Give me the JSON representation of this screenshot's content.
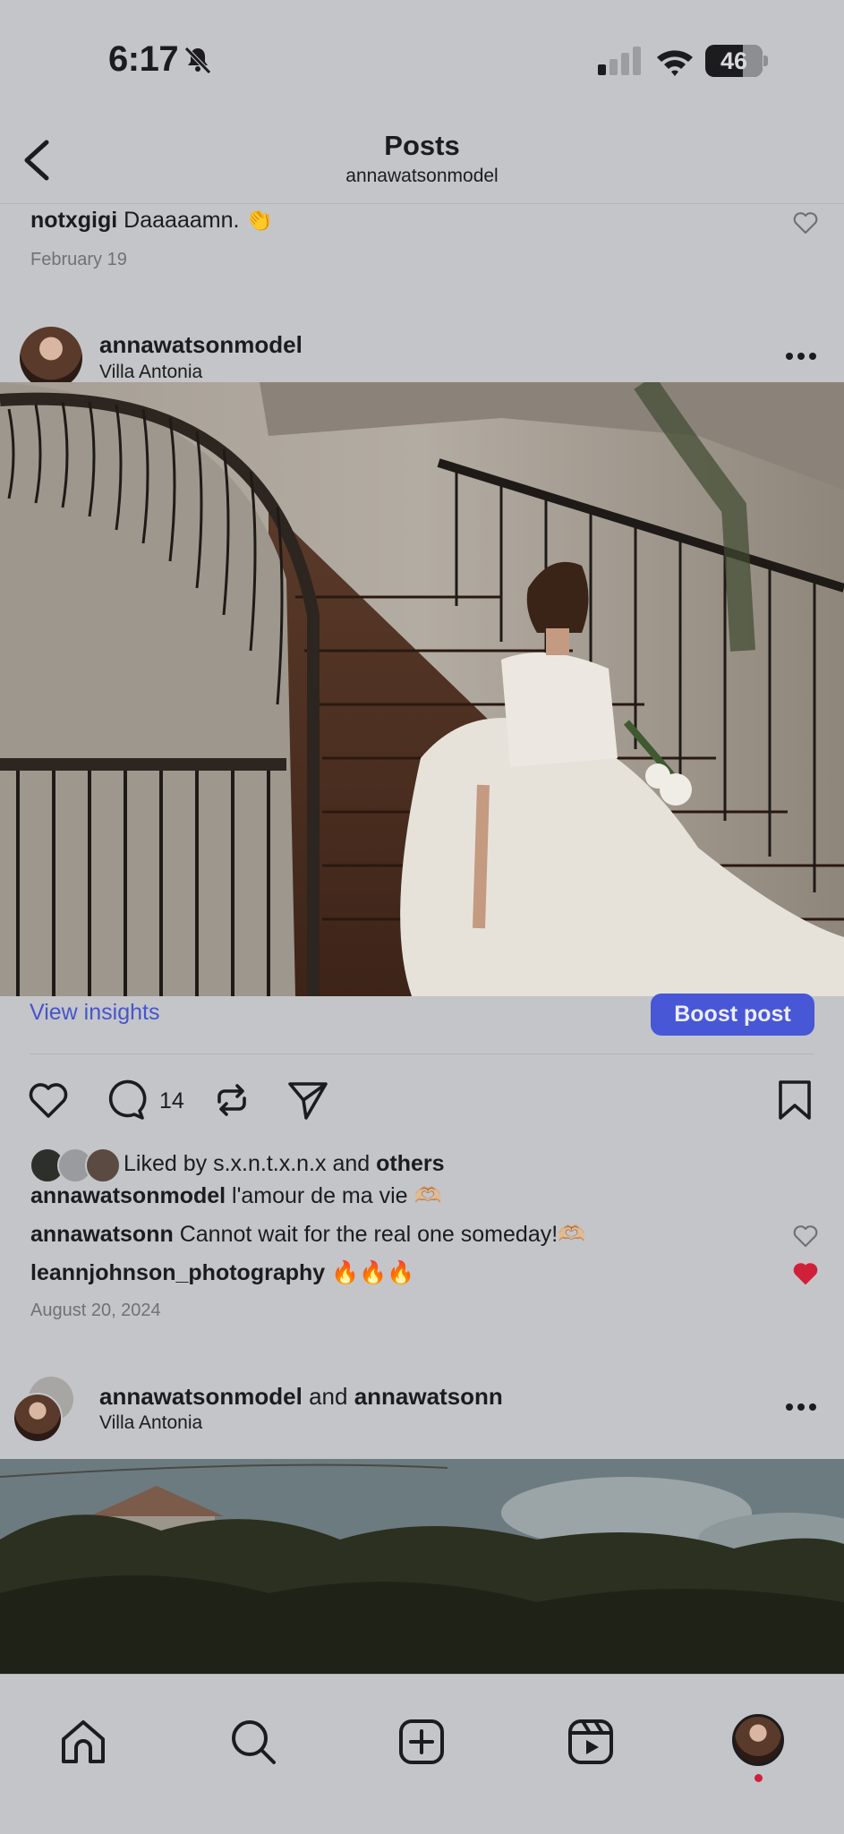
{
  "status": {
    "time": "6:17",
    "battery": "46"
  },
  "header": {
    "title": "Posts",
    "subtitle": "annawatsonmodel"
  },
  "top_comment": {
    "user": "notxgigi",
    "text": "Daaaaamn. 👏",
    "date": "February 19"
  },
  "post1": {
    "username": "annawatsonmodel",
    "location": "Villa Antonia",
    "insights_label": "View insights",
    "boost_label": "Boost post",
    "comment_count": "14",
    "liked_by_prefix": "Liked by",
    "liked_by_user": "s.x.n.t.x.n.x",
    "liked_by_and": "and",
    "liked_by_others": "others",
    "caption_user": "annawatsonmodel",
    "caption_text": "l'amour de ma vie 🫶🏼",
    "comments": [
      {
        "user": "annawatsonn",
        "text": "Cannot wait for the real one someday!🫶🏼",
        "liked": false
      },
      {
        "user": "leannjohnson_photography",
        "text": "🔥🔥🔥",
        "liked": true
      }
    ],
    "date": "August 20, 2024"
  },
  "post2": {
    "user1": "annawatsonmodel",
    "and": "and",
    "user2": "annawatsonn",
    "location": "Villa Antonia"
  },
  "tabbar": {
    "items": [
      "home-icon",
      "search-icon",
      "create-icon",
      "reels-icon",
      "profile-avatar"
    ]
  },
  "colors": {
    "accent": "#4757d6",
    "like": "#d0213b",
    "background": "#c4c5c9"
  }
}
